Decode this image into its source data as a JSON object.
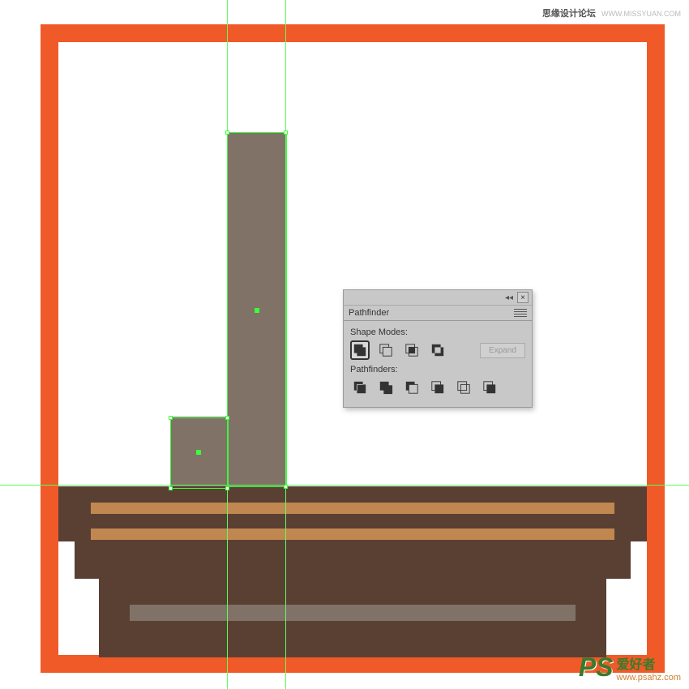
{
  "watermarks": {
    "top_cn": "思缘设计论坛",
    "top_url": "WWW.MISSYUAN.COM",
    "bottom_ps": "PS",
    "bottom_cn": "爱好者",
    "bottom_url": "www.psahz.com"
  },
  "panel": {
    "title": "Pathfinder",
    "section1": "Shape Modes:",
    "section2": "Pathfinders:",
    "expand": "Expand",
    "close": "×",
    "collapse": "◂◂",
    "icons": {
      "unite": "unite",
      "minus_front": "minus-front",
      "intersect": "intersect",
      "exclude": "exclude",
      "divide": "divide",
      "trim": "trim",
      "merge": "merge",
      "crop": "crop",
      "outline": "outline",
      "minus_back": "minus-back"
    }
  },
  "artwork": {
    "frame_color": "#f05a28",
    "mast_color": "#817267",
    "boat_color": "#5a4033",
    "stripe_color": "#c08850",
    "guide_color": "#5aff5a"
  }
}
